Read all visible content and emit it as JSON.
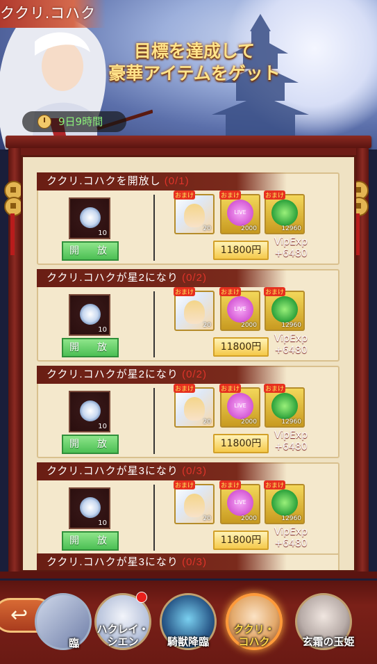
{
  "banner": {
    "event_title": "ククリ.コハク",
    "headline_line1": "目標を達成して",
    "headline_line2": "豪華アイテムをゲット",
    "timer": "9日9時間"
  },
  "tasks": [
    {
      "title": "ククリ.コハクを開放し",
      "progress": "(0/1)",
      "reward_count": "10",
      "claim_label": "開　放",
      "items": [
        {
          "tag": "おまけ",
          "count": "20"
        },
        {
          "tag": "おまけ",
          "count": "2000",
          "label": "LIVE"
        },
        {
          "tag": "おまけ",
          "count": "12960"
        }
      ],
      "price": "11800円",
      "vip_label": "VipExp",
      "vip_value": "+6480"
    },
    {
      "title": "ククリ.コハクが星2になり",
      "progress": "(0/2)",
      "reward_count": "10",
      "claim_label": "開　放",
      "items": [
        {
          "tag": "おまけ",
          "count": "20"
        },
        {
          "tag": "おまけ",
          "count": "2000",
          "label": "LIVE"
        },
        {
          "tag": "おまけ",
          "count": "12960"
        }
      ],
      "price": "11800円",
      "vip_label": "VipExp",
      "vip_value": "+6480"
    },
    {
      "title": "ククリ.コハクが星2になり",
      "progress": "(0/2)",
      "reward_count": "10",
      "claim_label": "開　放",
      "items": [
        {
          "tag": "おまけ",
          "count": "20"
        },
        {
          "tag": "おまけ",
          "count": "2000",
          "label": "LIVE"
        },
        {
          "tag": "おまけ",
          "count": "12960"
        }
      ],
      "price": "11800円",
      "vip_label": "VipExp",
      "vip_value": "+6480"
    },
    {
      "title": "ククリ.コハクが星3になり",
      "progress": "(0/3)",
      "reward_count": "10",
      "claim_label": "開　放",
      "items": [
        {
          "tag": "おまけ",
          "count": "20"
        },
        {
          "tag": "おまけ",
          "count": "2000",
          "label": "LIVE"
        },
        {
          "tag": "おまけ",
          "count": "12960"
        }
      ],
      "price": "11800円",
      "vip_label": "VipExp",
      "vip_value": "+6480"
    }
  ],
  "task_partial": {
    "title": "ククリ.コハクが星3になり",
    "progress": "(0/3)"
  },
  "nav": {
    "back_icon": "back-arrow-icon",
    "chevron": "«",
    "characters": [
      {
        "name": "臨",
        "selected": false
      },
      {
        "name_line1": "ハクレイ・",
        "name_line2": "シエン",
        "selected": false,
        "badge": true
      },
      {
        "name": "騎獣降臨",
        "selected": false
      },
      {
        "name_line1": "ククリ・",
        "name_line2": "コハク",
        "selected": true
      },
      {
        "name": "玄霜の玉姫",
        "selected": false
      }
    ]
  },
  "colors": {
    "accent_red": "#e0342a",
    "claim_green": "#4cbf54",
    "price_gold": "#f5c94a",
    "frame": "#6a1e14"
  }
}
